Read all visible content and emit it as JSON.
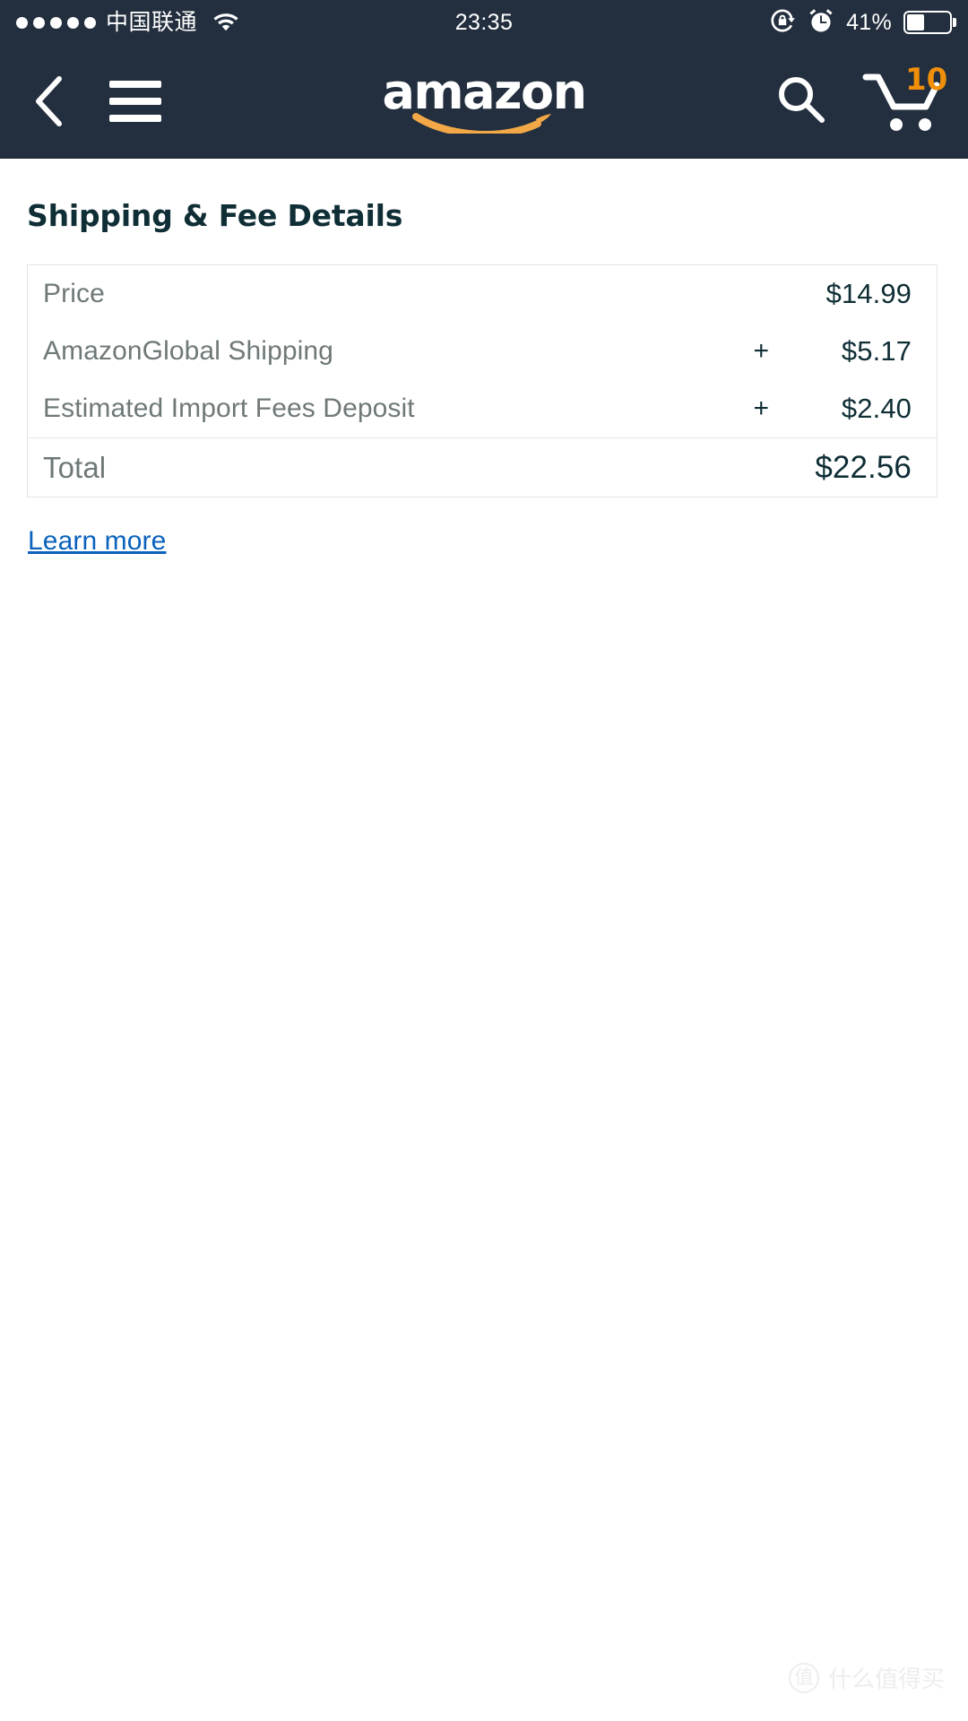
{
  "status_bar": {
    "signal_dots": 5,
    "carrier": "中国联通",
    "wifi_icon": "wifi-icon",
    "time": "23:35",
    "rotation_lock_icon": "rotation-lock-icon",
    "alarm_icon": "alarm-clock-icon",
    "battery_percent": "41%",
    "battery_level": 41,
    "background_color": "#232f3e"
  },
  "nav_bar": {
    "back_icon": "back-chevron-icon",
    "menu_icon": "hamburger-menu-icon",
    "logo_text": "amazon",
    "search_icon": "search-icon",
    "cart_icon": "shopping-cart-icon",
    "cart_count": "10",
    "cart_badge_color": "#f0900a",
    "background_color": "#232f3e"
  },
  "main": {
    "title": "Shipping & Fee Details",
    "fee_table": {
      "rows": [
        {
          "label": "Price",
          "sign": "",
          "value": "$14.99"
        },
        {
          "label": "AmazonGlobal Shipping",
          "sign": "+",
          "value": "$5.17"
        },
        {
          "label": "Estimated Import Fees Deposit",
          "sign": "+",
          "value": "$2.40"
        }
      ],
      "total": {
        "label": "Total",
        "sign": "",
        "value": "$22.56"
      }
    },
    "learn_more_label": "Learn more",
    "link_color": "#0a62bd"
  },
  "watermark": {
    "badge": "值",
    "text": "什么值得买"
  }
}
